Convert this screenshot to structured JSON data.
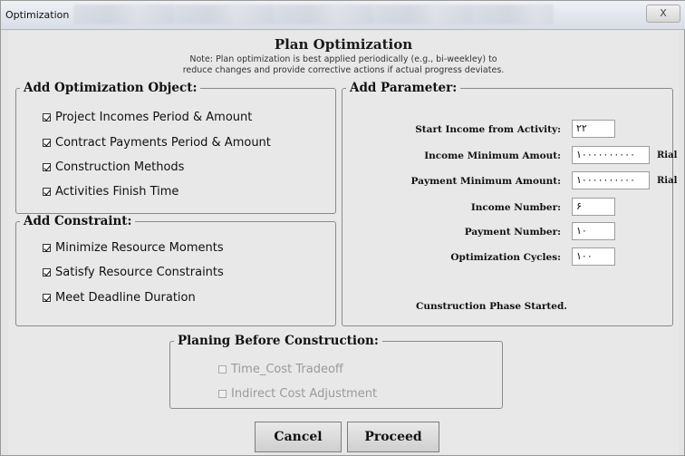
{
  "window": {
    "title": "Optimization",
    "close_label": "X"
  },
  "header": {
    "title": "Plan Optimization",
    "note_line1": "Note: Plan optimization is best applied periodically (e.g., bi-weekley) to",
    "note_line2": "reduce changes and provide corrective actions if actual progress deviates."
  },
  "optimization_object": {
    "legend": "Add Optimization Object:",
    "items": [
      {
        "label": "Project Incomes Period & Amount",
        "checked": true
      },
      {
        "label": "Contract Payments Period & Amount",
        "checked": true
      },
      {
        "label": "Construction Methods",
        "checked": true
      },
      {
        "label": "Activities Finish Time",
        "checked": true
      }
    ]
  },
  "constraint": {
    "legend": "Add Constraint:",
    "items": [
      {
        "label": "Minimize Resource Moments",
        "checked": true
      },
      {
        "label": "Satisfy Resource Constraints",
        "checked": true
      },
      {
        "label": "Meet Deadline Duration",
        "checked": true
      }
    ]
  },
  "parameter": {
    "legend": "Add Parameter:",
    "fields": [
      {
        "label": "Start Income from Activity:",
        "value": "۲۲",
        "unit": ""
      },
      {
        "label": "Income Minimum Amout:",
        "value": "۱۰۰۰۰۰۰۰۰۰۰",
        "unit": "Rial"
      },
      {
        "label": "Payment Minimum Amount:",
        "value": "۱۰۰۰۰۰۰۰۰۰۰",
        "unit": "Rial"
      },
      {
        "label": "Income Number:",
        "value": "۶",
        "unit": ""
      },
      {
        "label": "Payment Number:",
        "value": "۱۰",
        "unit": ""
      },
      {
        "label": "Optimization Cycles:",
        "value": "۱۰۰",
        "unit": ""
      }
    ],
    "status": "Cunstruction Phase Started."
  },
  "planning": {
    "legend": "Planing Before Construction:",
    "items": [
      {
        "label": "Time_Cost Tradeoff",
        "checked": false,
        "enabled": false
      },
      {
        "label": "Indirect Cost Adjustment",
        "checked": false,
        "enabled": false
      }
    ]
  },
  "buttons": {
    "cancel": "Cancel",
    "proceed": "Proceed"
  }
}
